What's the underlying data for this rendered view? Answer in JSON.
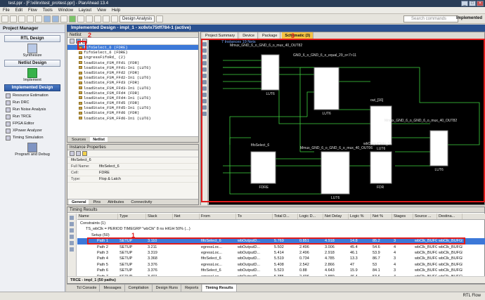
{
  "window": {
    "title": "test.ppr - [F:\\xilinx\\test_pro\\test.ppr] - PlanAhead 13.4"
  },
  "menu": [
    "File",
    "Edit",
    "Flow",
    "Tools",
    "Window",
    "Layout",
    "View",
    "Help"
  ],
  "toolbar": {
    "layout_dropdown": "Design Analysis",
    "search_placeholder": "Search commands",
    "mode": "Implemented"
  },
  "flow": {
    "title": "Project Manager",
    "sections": [
      {
        "label": "RTL Design",
        "items": [],
        "icon_label": "Synthesize"
      },
      {
        "label": "Netlist Design",
        "items": [],
        "icon_label": "Implement"
      },
      {
        "label": "Implemented Design",
        "items": [
          "Resource Estimation",
          "Run DRC",
          "Run Noise Analysis",
          "Run TRCE",
          "FPGA Editor",
          "XPower Analyzer",
          "Timing Simulation"
        ],
        "icon_label": "Program and Debug"
      }
    ]
  },
  "design_header": "Implemented Design - impl_1 - xc6vlx75tff784-1 (active)",
  "netlist": {
    "title": "Netlist",
    "rows": [
      "fifoSelect_6 (FDRE)",
      "fifoSelect_6 (FDRE)",
      "ingressFifoRd_ (2)",
      "loadState_FSM_FFd1 (FDR)",
      "loadState_FSM_FFd1-In1 (LUT6)",
      "loadState_FSM_FFd2 (FDR)",
      "loadState_FSM_FFd2-In1 (LUT6)",
      "loadState_FSM_FFd3 (FDR)",
      "loadState_FSM_FFd3-In1 (LUT6)",
      "loadState_FSM_FFd4 (FDR)",
      "loadState_FSM_FFd4-In1 (LUT6)",
      "loadState_FSM_FFd5 (FDR)",
      "loadState_FSM_FFd5-In1 (LUT6)",
      "loadState_FSM_FFd6 (FDR)",
      "loadState_FSM_FFd6-In1 (LUT6)"
    ],
    "tabs": [
      "Sources",
      "Netlist"
    ]
  },
  "properties": {
    "title": "Instance Properties",
    "instance": "fifoSelect_6",
    "fields": [
      {
        "k": "Full Name:",
        "v": "fifoSelect_6"
      },
      {
        "k": "Cell:",
        "v": "FDRE"
      },
      {
        "k": "Type:",
        "v": "Flop & Latch"
      }
    ],
    "tabs": [
      "General",
      "Pins",
      "Attributes",
      "Connectivity"
    ]
  },
  "schematic": {
    "tabs": [
      "Project Summary",
      "Device",
      "Package",
      "Schematic (3)"
    ],
    "info": "7 Instances  19 Nets",
    "cells": [
      {
        "name": "LUT6",
        "label": "Mmux_GND_6_o_GND_6_o_mux_40_OUT82"
      },
      {
        "name": "LUT6",
        "label": "GND_6_o_GND_6_o_equal_29_o<7>11"
      },
      {
        "name": "LUT6",
        "label": "out_[16]"
      },
      {
        "name": "LUT6",
        "label": "Mmux_GND_6_o_GND_6_o_mux_40_OUT82"
      },
      {
        "name": "FDRE",
        "label": "fifoSelect_6"
      },
      {
        "name": "LUT6",
        "label": "Mmux_GND_6_o_GND_6_o_mux_40_OUT06"
      },
      {
        "name": "FDR",
        "label": "wbOutputData_14"
      }
    ]
  },
  "annotations": [
    "1",
    "2",
    "3"
  ],
  "timing": {
    "title": "Timing Results",
    "columns": [
      "Name",
      "Type",
      "Slack",
      "Net",
      "From",
      "To",
      "Total D...",
      "Logic D...",
      "Net Delay",
      "Logic %",
      "Net %",
      "Stages",
      "Source ...",
      "Destina..."
    ],
    "constraints": "Constraints (1)",
    "group": "TS_wbClk = PERIOD TIMEGRP \"wbClk\" 8 ns HIGH 50% (...)",
    "setup": "Setup (50)",
    "paths": [
      {
        "name": "Path 1",
        "type": "SETUP",
        "slack": "3.110",
        "from": "fifoSelect_6",
        "to": "wbOutputD...",
        "total": "5.769",
        "logic": "0.851",
        "net": "4.918",
        "lp": "14.8",
        "np": "85.2",
        "stages": "3",
        "src": "wbClk_BUFGP",
        "dst": "wbClk_BUFGP"
      },
      {
        "name": "Path 2",
        "type": "SETUP",
        "slack": "3.211",
        "from": "egressLoc...",
        "to": "wbOutputD...",
        "total": "5.502",
        "logic": "2.496",
        "net": "3.006",
        "lp": "45.4",
        "np": "54.6",
        "stages": "4",
        "src": "wbClk_BUFGP",
        "dst": "wbClk_BUFGP"
      },
      {
        "name": "Path 3",
        "type": "SETUP",
        "slack": "3.319",
        "from": "egressLoc...",
        "to": "wbOutputD...",
        "total": "5.414",
        "logic": "2.496",
        "net": "2.918",
        "lp": "46.1",
        "np": "53.9",
        "stages": "4",
        "src": "wbClk_BUFGP",
        "dst": "wbClk_BUFGP"
      },
      {
        "name": "Path 4",
        "type": "SETUP",
        "slack": "3.368",
        "from": "fifoSelect_6",
        "to": "wbOutputD...",
        "total": "5.519",
        "logic": "0.734",
        "net": "4.785",
        "lp": "13.3",
        "np": "86.7",
        "stages": "3",
        "src": "wbClk_BUFGP",
        "dst": "wbClk_BUFGP"
      },
      {
        "name": "Path 5",
        "type": "SETUP",
        "slack": "3.376",
        "from": "egressLoc...",
        "to": "wbOutputD...",
        "total": "5.408",
        "logic": "2.542",
        "net": "2.866",
        "lp": "47",
        "np": "53",
        "stages": "4",
        "src": "wbClk_BUFGP",
        "dst": "wbClk_BUFGP"
      },
      {
        "name": "Path 6",
        "type": "SETUP",
        "slack": "3.376",
        "from": "fifoSelect_6",
        "to": "wbOutputD...",
        "total": "5.523",
        "logic": "0.88",
        "net": "4.643",
        "lp": "15.9",
        "np": "84.1",
        "stages": "3",
        "src": "wbClk_BUFGP",
        "dst": "wbClk_BUFGP"
      },
      {
        "name": "Path 7",
        "type": "SETUP",
        "slack": "3.401",
        "from": "egressLoc...",
        "to": "wbOutputD...",
        "total": "5.385",
        "logic": "2.496",
        "net": "2.889",
        "lp": "46.4",
        "np": "53.6",
        "stages": "4",
        "src": "wbClk_BUFGP",
        "dst": "wbClk_BUFGP"
      }
    ],
    "run_label": "TRCE - impl_1 (50 paths)"
  },
  "bottom_tabs": [
    "Tcl Console",
    "Messages",
    "Compilation",
    "Design Runs",
    "Reports",
    "Timing Results"
  ],
  "status": "RTL Flow"
}
